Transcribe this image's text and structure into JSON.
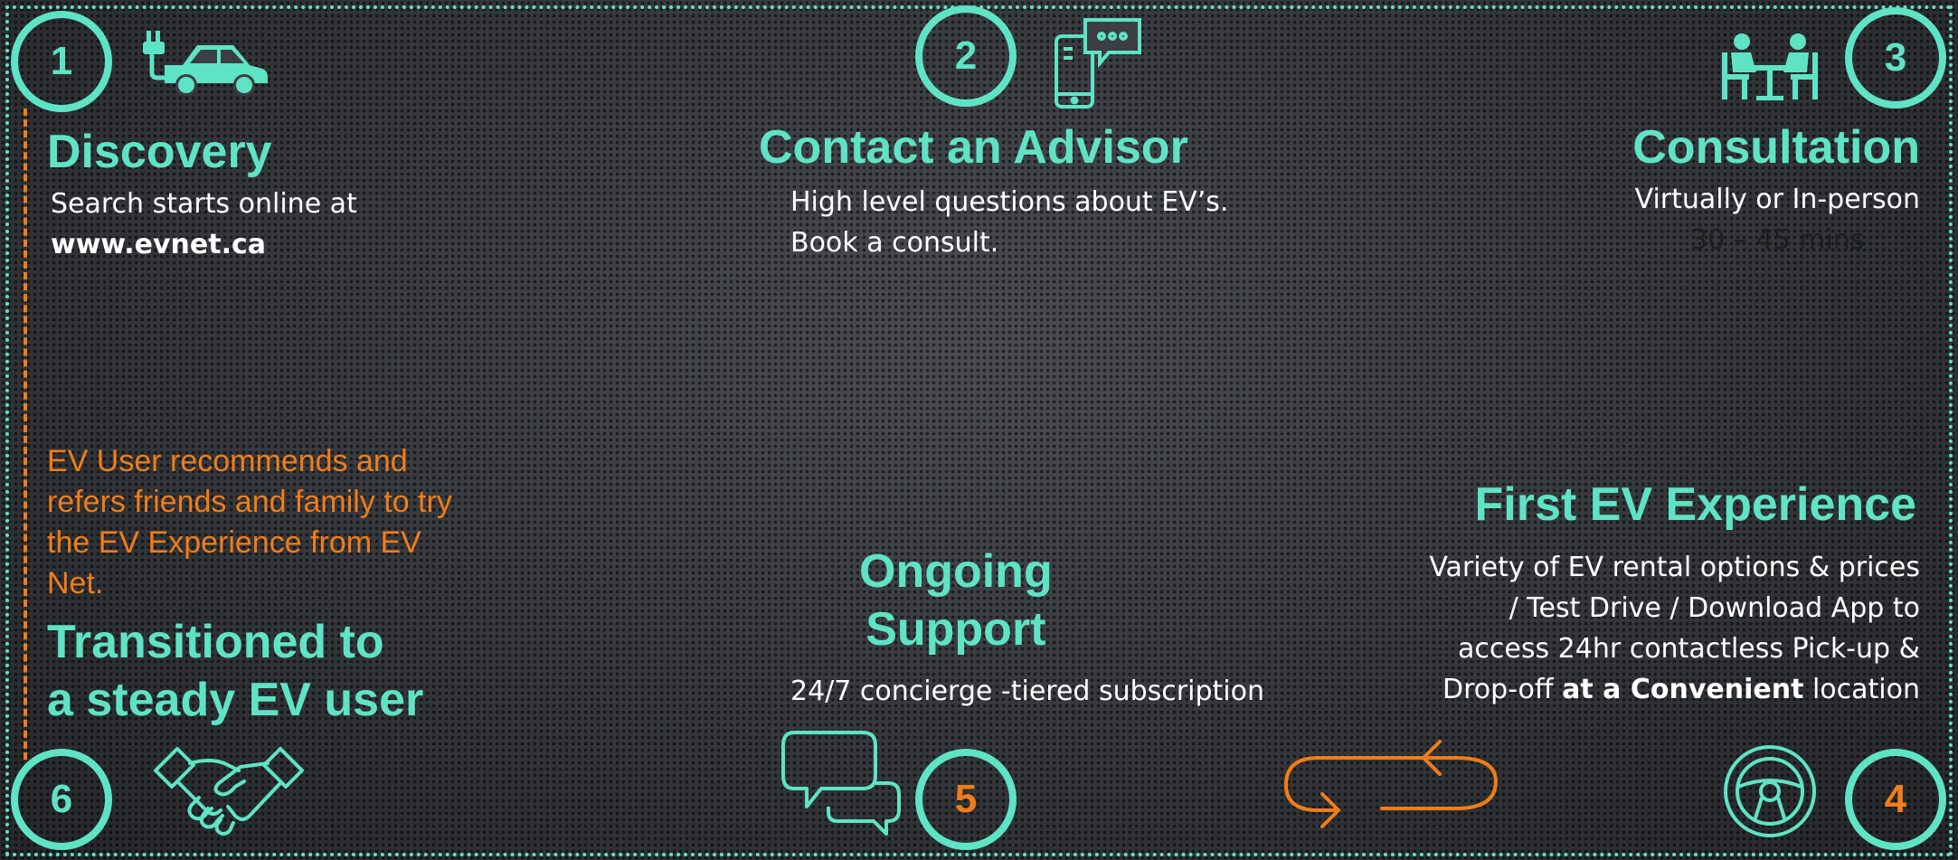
{
  "colors": {
    "teal": "#5fe3c5",
    "orange": "#f07d19",
    "text": "#ffffff",
    "dark_text": "#1e1e1e"
  },
  "steps": {
    "discovery": {
      "number": "1",
      "title": "Discovery",
      "line1": "Search starts online at",
      "line2": "www.evnet.ca",
      "icon": "electric-car-icon"
    },
    "advisor": {
      "number": "2",
      "title": "Contact an Advisor",
      "line1": "High level questions about EV’s.",
      "line2": "Book a consult.",
      "icon": "phone-chat-icon"
    },
    "consultation": {
      "number": "3",
      "title": "Consultation",
      "line1": "Virtually or In-person",
      "line2": "30 – 45 mins",
      "icon": "meeting-icon"
    },
    "first_experience": {
      "number": "4",
      "title": "First EV Experience",
      "line1": "Variety of EV rental options & prices",
      "line2": "/ Test Drive / Download App to",
      "line3": "access 24hr contactless Pick-up &",
      "line4_pre": "Drop-off ",
      "line4_bold": "at a Convenient",
      "line4_post": " location",
      "icon": "steering-wheel-icon"
    },
    "ongoing": {
      "number": "5",
      "title_line1": "Ongoing",
      "title_line2": "Support",
      "line1": "24/7 concierge -tiered subscription",
      "icon": "chat-bubbles-icon"
    },
    "steady_user": {
      "number": "6",
      "title_line1": "Transitioned to",
      "title_line2": "a steady  EV user",
      "icon": "handshake-icon"
    }
  },
  "referral_text": {
    "line1": "EV User recommends and",
    "line2": "refers friends and family to try",
    "line3": "the EV Experience from EV",
    "line4": "Net."
  },
  "connector_icon": "loop-arrows-icon"
}
